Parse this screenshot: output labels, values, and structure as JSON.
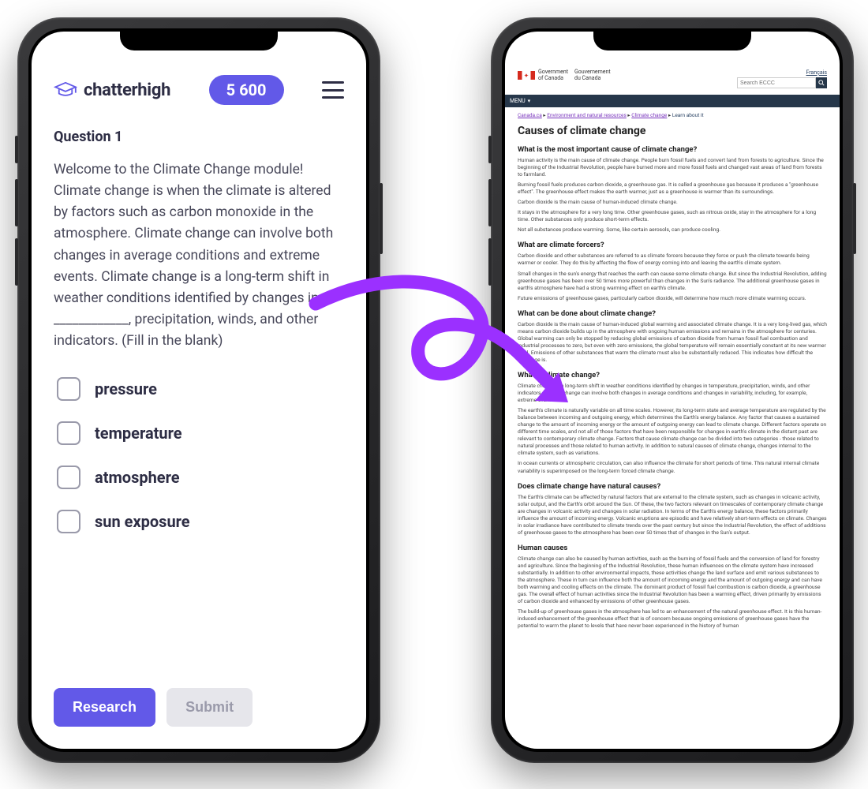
{
  "left": {
    "brand": "chatterhigh",
    "points": "5 600",
    "question_label": "Question 1",
    "question_body": "Welcome to the Climate Change module! Climate change is when the climate is altered by factors such as carbon monoxide in the atmosphere. Climate change can involve both changes in average conditions and extreme events. Climate change is a long-term shift in weather conditions identified by changes in ____________, precipitation, winds, and other indicators. (Fill in the blank)",
    "options": [
      "pressure",
      "temperature",
      "atmosphere",
      "sun exposure"
    ],
    "research_btn": "Research",
    "submit_btn": "Submit"
  },
  "right": {
    "lang_link": "Français",
    "gov_en": "Government\nof Canada",
    "gov_fr": "Gouvernement\ndu Canada",
    "search_placeholder": "Search ECCC",
    "menu_label": "MENU",
    "crumbs": [
      "Canada.ca",
      "Environment and natural resources",
      "Climate change",
      "Learn about it"
    ],
    "h1": "Causes of climate change",
    "sections": [
      {
        "h": "What is the most important cause of climate change?",
        "p": [
          "Human activity is the main cause of climate change. People burn fossil fuels and convert land from forests to agriculture. Since the beginning of the Industrial Revolution, people have burned more and more fossil fuels and changed vast areas of land from forests to farmland.",
          "Burning fossil fuels produces carbon dioxide, a greenhouse gas. It is called a greenhouse gas because it produces a \"greenhouse effect\". The greenhouse effect makes the earth warmer, just as a greenhouse is warmer than its surroundings.",
          "Carbon dioxide is the main cause of human-induced climate change.",
          "It stays in the atmosphere for a very long time. Other greenhouse gases, such as nitrous oxide, stay in the atmosphere for a long time. Other substances only produce short-term effects.",
          "Not all substances produce warming. Some, like certain aerosols, can produce cooling."
        ]
      },
      {
        "h": "What are climate forcers?",
        "p": [
          "Carbon dioxide and other substances are referred to as climate forcers because they force or push the climate towards being warmer or cooler. They do this by affecting the flow of energy coming into and leaving the earth's climate system.",
          "Small changes in the sun's energy that reaches the earth can cause some climate change. But since the Industrial Revolution, adding greenhouse gases has been over 50 times more powerful than changes in the Sun's radiance. The additional greenhouse gases in earth's atmosphere have had a strong warming effect on earth's climate.",
          "Future emissions of greenhouse gases, particularly carbon dioxide, will determine how much more climate warming occurs."
        ]
      },
      {
        "h": "What can be done about climate change?",
        "p": [
          "Carbon dioxide is the main cause of human-induced global warming and associated climate change. It is a very long-lived gas, which means carbon dioxide builds up in the atmosphere with ongoing human emissions and remains in the atmosphere for centuries. Global warming can only be stopped by reducing global emissions of carbon dioxide from human fossil fuel combustion and industrial processes to zero, but even with zero emissions, the global temperature will remain essentially constant at its new warmer level. Emissions of other substances that warm the climate must also be substantially reduced. This indicates how difficult the challenge is."
        ]
      },
      {
        "h": "What is climate change?",
        "p": [
          "Climate change is a long-term shift in weather conditions identified by changes in temperature, precipitation, winds, and other indicators. Climate change can involve both changes in average conditions and changes in variability, including, for example, extreme events.",
          "The earth's climate is naturally variable on all time scales. However, its long-term state and average temperature are regulated by the balance between incoming and outgoing energy, which determines the Earth's energy balance. Any factor that causes a sustained change to the amount of incoming energy or the amount of outgoing energy can lead to climate change. Different factors operate on different time scales, and not all of those factors that have been responsible for changes in earth's climate in the distant past are relevant to contemporary climate change. Factors that cause climate change can be divided into two categories - those related to natural processes and those related to human activity. In addition to natural causes of climate change, changes internal to the climate system, such as variations.",
          "In ocean currents or atmospheric circulation, can also influence the climate for short periods of time. This natural internal climate variability is superimposed on the long-term forced climate change."
        ]
      },
      {
        "h": "Does climate change have natural causes?",
        "p": [
          "The Earth's climate can be affected by natural factors that are external to the climate system, such as changes in volcanic activity, solar output, and the Earth's orbit around the Sun. Of these, the two factors relevant on timescales of contemporary climate change are changes in volcanic activity and changes in solar radiation. In terms of the Earth's energy balance, these factors primarily influence the amount of incoming energy. Volcanic eruptions are episodic and have relatively short-term effects on climate. Changes in solar irradiance have contributed to climate trends over the past century but since the Industrial Revolution, the effect of additions of greenhouse gases to the atmosphere has been over 50 times that of changes in the Sun's output."
        ]
      },
      {
        "h": "Human causes",
        "p": [
          "Climate change can also be caused by human activities, such as the burning of fossil fuels and the conversion of land for forestry and agriculture. Since the beginning of the Industrial Revolution, these human influences on the climate system have increased substantially. In addition to other environmental impacts, these activities change the land surface and emit various substances to the atmosphere. These in turn can influence both the amount of incoming energy and the amount of outgoing energy and can have both warming and cooling effects on the climate.  The dominant product of fossil fuel combustion is carbon dioxide, a greenhouse gas. The overall effect of human activities since the Industrial Revolution has been a warming effect, driven primarily by emissions of carbon dioxide and enhanced by emissions of other greenhouse gases.",
          "The build-up of greenhouse gases in the atmosphere has led to an enhancement of the natural greenhouse effect.  It is this human-induced enhancement of the greenhouse effect that is of concern because ongoing emissions of greenhouse gases have the potential to warm the planet to levels that have never been experienced in the history of human"
        ]
      }
    ]
  }
}
